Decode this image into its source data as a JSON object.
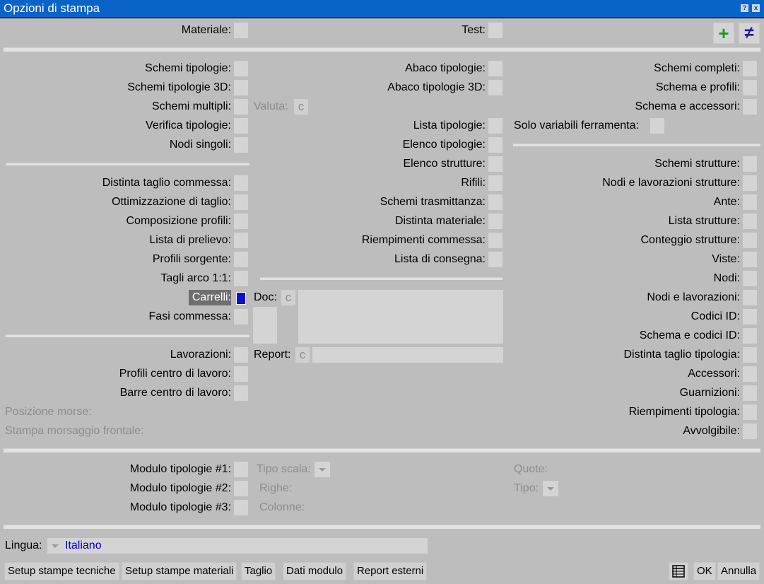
{
  "window": {
    "title": "Opzioni di stampa",
    "help_icon": "?",
    "close_icon": "x"
  },
  "top": {
    "materiale": "Materiale:",
    "test": "Test:",
    "add_icon": "plus-icon",
    "neq_icon": "not-equal-icon",
    "add_glyph": "+",
    "neq_glyph": "≠"
  },
  "col1": {
    "items": [
      "Schemi tipologie:",
      "Schemi tipologie 3D:",
      "Schemi multipli:",
      "Verifica tipologie:",
      "Nodi singoli:"
    ],
    "items2": [
      "Distinta taglio commessa:",
      "Ottimizzazione di taglio:",
      "Composizione profili:",
      "Lista di prelievo:",
      "Profili sorgente:",
      "Tagli arco 1:1:",
      "Carrelli:",
      "Fasi commessa:"
    ],
    "items3": [
      "Lavorazioni:",
      "Profili centro di lavoro:",
      "Barre centro di lavoro:"
    ],
    "disabled": [
      "Posizione morse:",
      "Stampa morsaggio frontale:"
    ],
    "valuta": "Valuta:",
    "valuta_value": "c"
  },
  "col2": {
    "items": [
      "Abaco tipologie:",
      "Abaco tipologie 3D:"
    ],
    "items2": [
      "Lista tipologie:",
      "Elenco tipologie:",
      "Elenco strutture:",
      "Rifili:",
      "Schemi trasmittanza:",
      "Distinta materiale:",
      "Riempimenti commessa:",
      "Lista di consegna:"
    ],
    "doc": "Doc:",
    "doc_value": "c",
    "report": "Report:",
    "report_value": "c"
  },
  "col3": {
    "items": [
      "Schemi completi:",
      "Schema e profili:",
      "Schema e accessori:"
    ],
    "solo": "Solo variabili ferramenta:",
    "items2": [
      "Schemi strutture:",
      "Nodi e lavorazioni strutture:",
      "Ante:",
      "Lista strutture:",
      "Conteggio strutture:",
      "Viste:",
      "Nodi:",
      "Nodi e lavorazioni:",
      "Codici ID:",
      "Schema e codici ID:",
      "Distinta taglio tipologia:",
      "Accessori:",
      "Guarnizioni:",
      "Riempimenti tipologia:",
      "Avvolgibile:"
    ]
  },
  "moduli": {
    "items": [
      "Modulo tipologie #1:",
      "Modulo tipologie #2:",
      "Modulo tipologie #3:"
    ],
    "tipo_scala": "Tipo scala:",
    "righe": "Righe:",
    "colonne": "Colonne:",
    "quote": "Quote:",
    "tipo": "Tipo:"
  },
  "lingua": {
    "label": "Lingua:",
    "value": "Italiano",
    "value_color": "#0000c8"
  },
  "buttons": {
    "setup_tecniche": "Setup stampe tecniche",
    "setup_materiali": "Setup stampe materiali",
    "taglio": "Taglio",
    "dati_modulo": "Dati modulo",
    "report_esterni": "Report esterni",
    "ok": "OK",
    "annulla": "Annulla",
    "grid_icon": "table-icon"
  },
  "colors": {
    "titlebar": "#0a64c8",
    "background": "#bdbdbd",
    "highlight": "#6e6e6e",
    "checked": "#1010c8",
    "plus": "#1e9a1e",
    "neq": "#1a1a9a"
  }
}
